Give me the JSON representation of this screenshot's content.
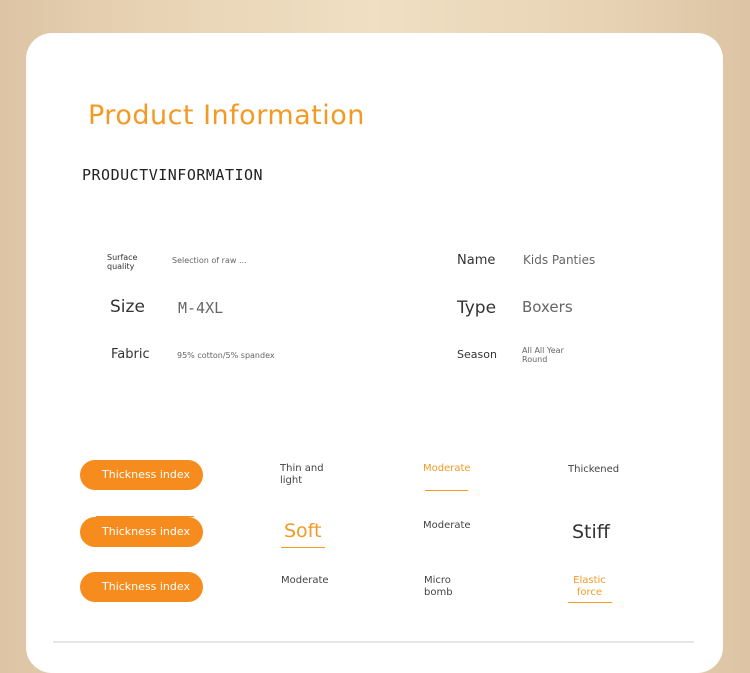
{
  "header": {
    "title": "Product Information",
    "subtitle": "PRODUCTVINFORMATION"
  },
  "info": {
    "surface_quality_label": "Surface quality",
    "surface_quality_value": "Selection of raw ...",
    "name_label": "Name",
    "name_value": "Kids Panties",
    "size_label": "Size",
    "size_value": "M-4XL",
    "type_label": "Type",
    "type_value": "Boxers",
    "fabric_label": "Fabric",
    "fabric_value": "95% cotton/5% spandex",
    "season_label": "Season",
    "season_value": "All All Year Round"
  },
  "attributes": [
    {
      "label": "Thickness index",
      "options": [
        "Thin and light",
        "Moderate",
        "Thickened"
      ],
      "selected": 1
    },
    {
      "label": "Thickness index",
      "options": [
        "Soft",
        "Moderate",
        "Stiff"
      ],
      "selected": 0
    },
    {
      "label": "Thickness index",
      "options": [
        "Moderate",
        "Micro bomb",
        "Elastic force"
      ],
      "selected": 2
    }
  ],
  "colors": {
    "accent": "#f39a25",
    "pill": "#f68c1e",
    "card": "#ffffff",
    "background": "#e8d3b4"
  }
}
